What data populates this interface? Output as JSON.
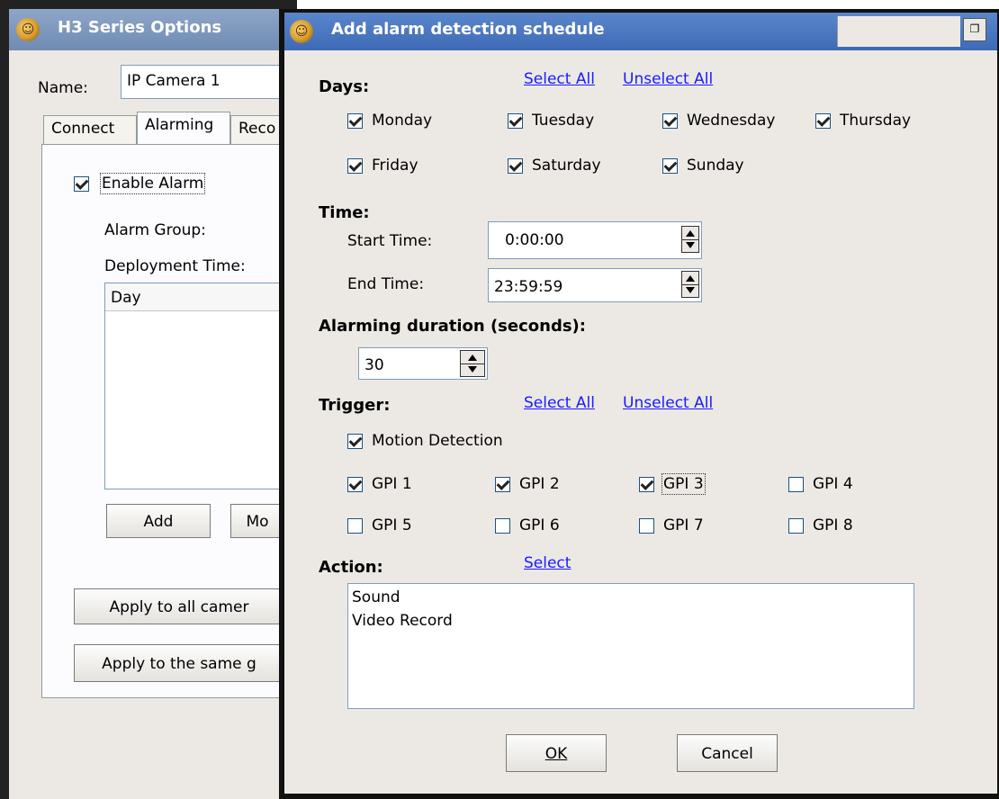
{
  "background_window": {
    "title": "H3 Series Options",
    "name_label": "Name:",
    "name_value": "IP Camera 1",
    "tabs": [
      {
        "label": "Connect"
      },
      {
        "label": "Alarming"
      },
      {
        "label": "Reco"
      }
    ],
    "enable_alarm_label": "Enable Alarm",
    "enable_alarm_checked": true,
    "alarm_group_label": "Alarm Group:",
    "deployment_time_label": "Deployment Time:",
    "list_header": "Day",
    "add_label": "Add",
    "modify_label": "Mo",
    "apply_all_label": "Apply to all camer",
    "apply_same_group_label": "Apply to the same g"
  },
  "dialog": {
    "title": "Add alarm detection schedule",
    "days": {
      "label": "Days:",
      "select_all": "Select All",
      "unselect_all": "Unselect All",
      "items": [
        {
          "label": "Monday",
          "checked": true
        },
        {
          "label": "Tuesday",
          "checked": true
        },
        {
          "label": "Wednesday",
          "checked": true
        },
        {
          "label": "Thursday",
          "checked": true
        },
        {
          "label": "Friday",
          "checked": true
        },
        {
          "label": "Saturday",
          "checked": true
        },
        {
          "label": "Sunday",
          "checked": true
        }
      ]
    },
    "time": {
      "label": "Time:",
      "start_label": "Start Time:",
      "start_value": "0:00:00",
      "end_label": "End Time:",
      "end_value": "23:59:59"
    },
    "duration": {
      "label": "Alarming duration (seconds):",
      "value": "30"
    },
    "trigger": {
      "label": "Trigger:",
      "select_all": "Select All",
      "unselect_all": "Unselect All",
      "motion": {
        "label": "Motion Detection",
        "checked": true
      },
      "gpi": [
        {
          "label": "GPI 1",
          "checked": true
        },
        {
          "label": "GPI 2",
          "checked": true
        },
        {
          "label": "GPI 3",
          "checked": true
        },
        {
          "label": "GPI 4",
          "checked": false
        },
        {
          "label": "GPI 5",
          "checked": false
        },
        {
          "label": "GPI 6",
          "checked": false
        },
        {
          "label": "GPI 7",
          "checked": false
        },
        {
          "label": "GPI 8",
          "checked": false
        }
      ]
    },
    "action": {
      "label": "Action:",
      "select": "Select",
      "items": [
        "Sound",
        "Video Record"
      ]
    },
    "ok_label": "OK",
    "cancel_label": "Cancel"
  }
}
